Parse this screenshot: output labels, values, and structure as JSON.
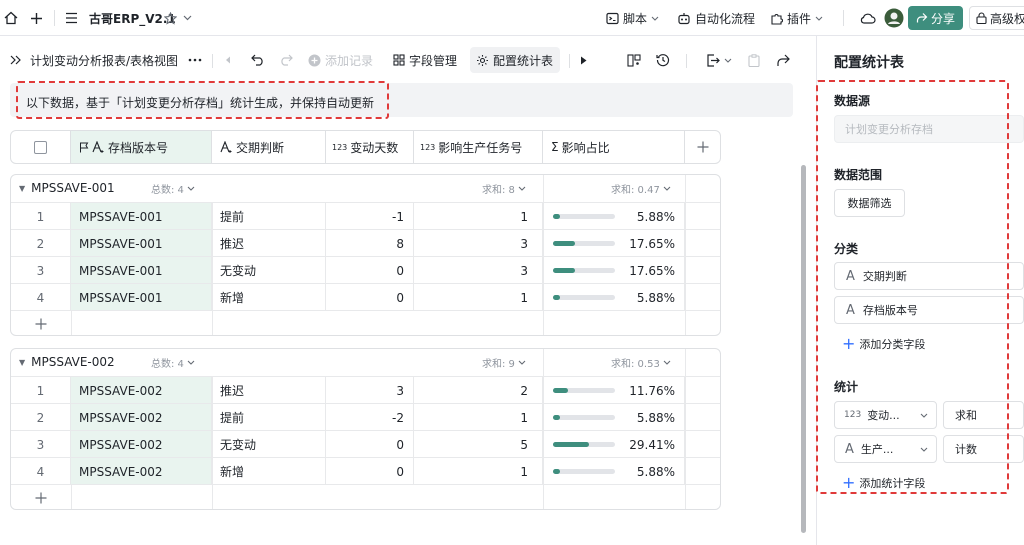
{
  "topbar": {
    "app_title": "古哥ERP_V2.1",
    "script_label": "脚本",
    "automation_label": "自动化流程",
    "plugin_label": "插件",
    "share_label": "分享",
    "advanced_label": "高级权"
  },
  "toolbar": {
    "breadcrumb": "计划变动分析报表/表格视图",
    "add_record_label": "添加记录",
    "field_manage_label": "字段管理",
    "config_stats_label": "配置统计表"
  },
  "notice": {
    "text": "以下数据，基于「计划变更分析存档」统计生成，并保持自动更新"
  },
  "table": {
    "columns": {
      "version": "存档版本号",
      "judge": "交期判断",
      "days": "变动天数",
      "tasks": "影响生产任务号",
      "ratio": "影响占比"
    },
    "groups": [
      {
        "name": "MPSSAVE-001",
        "total_label": "总数: 4",
        "sum_tasks_label": "求和: 8",
        "sum_ratio_label": "求和: 0.47",
        "rows": [
          {
            "idx": "1",
            "version": "MPSSAVE-001",
            "judge": "提前",
            "days": "-1",
            "tasks": "1",
            "ratio": 0.0588,
            "ratio_text": "5.88%"
          },
          {
            "idx": "2",
            "version": "MPSSAVE-001",
            "judge": "推迟",
            "days": "8",
            "tasks": "3",
            "ratio": 0.1765,
            "ratio_text": "17.65%"
          },
          {
            "idx": "3",
            "version": "MPSSAVE-001",
            "judge": "无变动",
            "days": "0",
            "tasks": "3",
            "ratio": 0.1765,
            "ratio_text": "17.65%"
          },
          {
            "idx": "4",
            "version": "MPSSAVE-001",
            "judge": "新增",
            "days": "0",
            "tasks": "1",
            "ratio": 0.0588,
            "ratio_text": "5.88%"
          }
        ]
      },
      {
        "name": "MPSSAVE-002",
        "total_label": "总数: 4",
        "sum_tasks_label": "求和: 9",
        "sum_ratio_label": "求和: 0.53",
        "rows": [
          {
            "idx": "1",
            "version": "MPSSAVE-002",
            "judge": "推迟",
            "days": "3",
            "tasks": "2",
            "ratio": 0.1176,
            "ratio_text": "11.76%"
          },
          {
            "idx": "2",
            "version": "MPSSAVE-002",
            "judge": "提前",
            "days": "-2",
            "tasks": "1",
            "ratio": 0.0588,
            "ratio_text": "5.88%"
          },
          {
            "idx": "3",
            "version": "MPSSAVE-002",
            "judge": "无变动",
            "days": "0",
            "tasks": "5",
            "ratio": 0.2941,
            "ratio_text": "29.41%"
          },
          {
            "idx": "4",
            "version": "MPSSAVE-002",
            "judge": "新增",
            "days": "0",
            "tasks": "1",
            "ratio": 0.0588,
            "ratio_text": "5.88%"
          }
        ]
      }
    ]
  },
  "panel": {
    "title": "配置统计表",
    "datasource_label": "数据源",
    "datasource_value": "计划变更分析存档",
    "range_label": "数据范围",
    "filter_button": "数据筛选",
    "category_label": "分类",
    "category_fields": [
      "交期判断",
      "存档版本号"
    ],
    "add_category": "添加分类字段",
    "stats_label": "统计",
    "stats_fields": [
      {
        "field": "变动...",
        "agg": "求和",
        "icon": "123"
      },
      {
        "field": "生产...",
        "agg": "计数",
        "icon": "A"
      }
    ],
    "add_stats": "添加统计字段"
  },
  "colors": {
    "accent": "#3e8e7e",
    "highlight": "#e03a3a",
    "version_bg": "#e9f4ef"
  }
}
